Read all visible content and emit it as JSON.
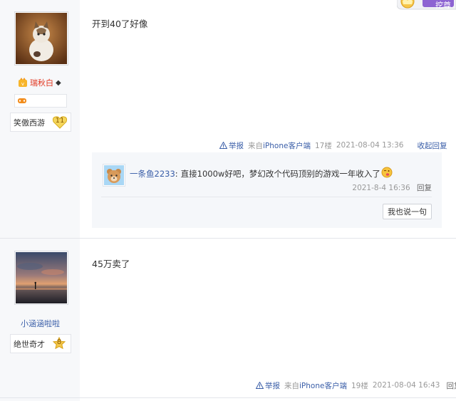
{
  "colors": {
    "link": "#3a5ea8",
    "username_vip": "#e1341e",
    "meta": "#999999",
    "sidebar_bg": "#f7f8fa"
  },
  "top_badge": {
    "label": "挖尊"
  },
  "post1": {
    "author": {
      "name": "瑞秋白",
      "symbol": "◆",
      "title": "笑傲西游",
      "level": "11"
    },
    "content": "开到40了好像",
    "tail": {
      "report": "举报",
      "source_prefix": "来自",
      "source_link": "iPhone客户端",
      "floor": "17楼",
      "time": "2021-08-04 13:36",
      "collapse": "收起回复"
    },
    "comment": {
      "author": "一条鱼2233",
      "colon": ":",
      "text": "直接1000w好吧，梦幻改个代码顶别的游戏一年收入了",
      "emoji": "tongue-emoji",
      "time": "2021-8-4 16:36",
      "reply": "回复"
    },
    "say_button": "我也说一句"
  },
  "post2": {
    "author": {
      "name": "小涵涵啦啦",
      "title": "绝世奇才",
      "level": "8"
    },
    "content": "45万卖了",
    "tail": {
      "report": "举报",
      "source_prefix": "来自",
      "source_link": "iPhone客户端",
      "floor": "19楼",
      "time": "2021-08-04 16:43",
      "reply": "回复"
    }
  }
}
